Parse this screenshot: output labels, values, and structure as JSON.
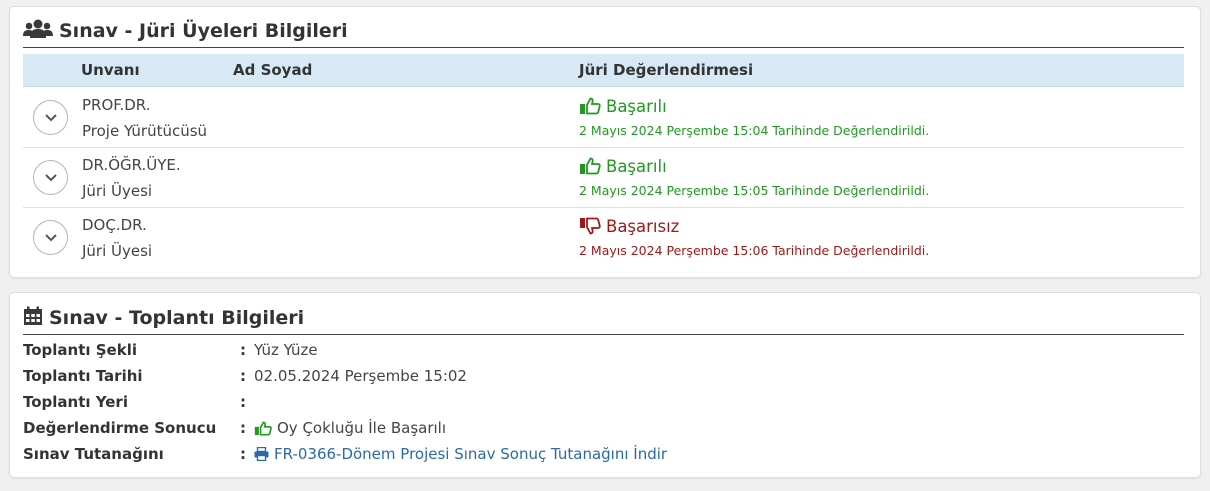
{
  "juri": {
    "title": "Sınav - Jüri Üyeleri Bilgileri",
    "headers": {
      "unvan": "Unvanı",
      "ad_soyad": "Ad Soyad",
      "degerlendirme": "Jüri Değerlendirmesi"
    },
    "rows": [
      {
        "unvan": "PROF.DR.",
        "rol": "Proje Yürütücüsü",
        "durum": "Başarılı",
        "tarih": "2 Mayıs 2024 Perşembe 15:04 Tarihinde Değerlendirildi.",
        "status_color": "#1f9a1f"
      },
      {
        "unvan": "DR.ÖĞR.ÜYE.",
        "rol": "Jüri Üyesi",
        "durum": "Başarılı",
        "tarih": "2 Mayıs 2024 Perşembe 15:05 Tarihinde Değerlendirildi.",
        "status_color": "#1f9a1f"
      },
      {
        "unvan": "DOÇ.DR.",
        "rol": "Jüri Üyesi",
        "durum": "Başarısız",
        "tarih": "2 Mayıs 2024 Perşembe 15:06 Tarihinde Değerlendirildi.",
        "status_color": "#a31717"
      }
    ]
  },
  "toplanti": {
    "title": "Sınav - Toplantı Bilgileri",
    "sep": ":",
    "sekli_label": "Toplantı Şekli",
    "sekli_value": "Yüz Yüze",
    "tarihi_label": "Toplantı Tarihi",
    "tarihi_value": "02.05.2024 Perşembe 15:02",
    "yeri_label": "Toplantı Yeri",
    "yeri_value": "",
    "sonuc_label": "Değerlendirme Sonucu",
    "sonuc_value": "Oy Çokluğu İle Başarılı",
    "tutanak_label": "Sınav Tutanağını",
    "tutanak_value": "FR-0366-Dönem Projesi Sınav Sonuç Tutanağını İndir"
  },
  "icons": {
    "users": "users-icon",
    "calendar": "calendar-icon",
    "expand": "chevron-down-icon",
    "success": "thumbs-up-icon",
    "fail": "thumbs-down-icon",
    "print": "print-icon"
  },
  "colors": {
    "success": "#1f9a1f",
    "fail": "#a31717",
    "link": "#2a6aa8",
    "header_bg": "#d7e9f5"
  }
}
